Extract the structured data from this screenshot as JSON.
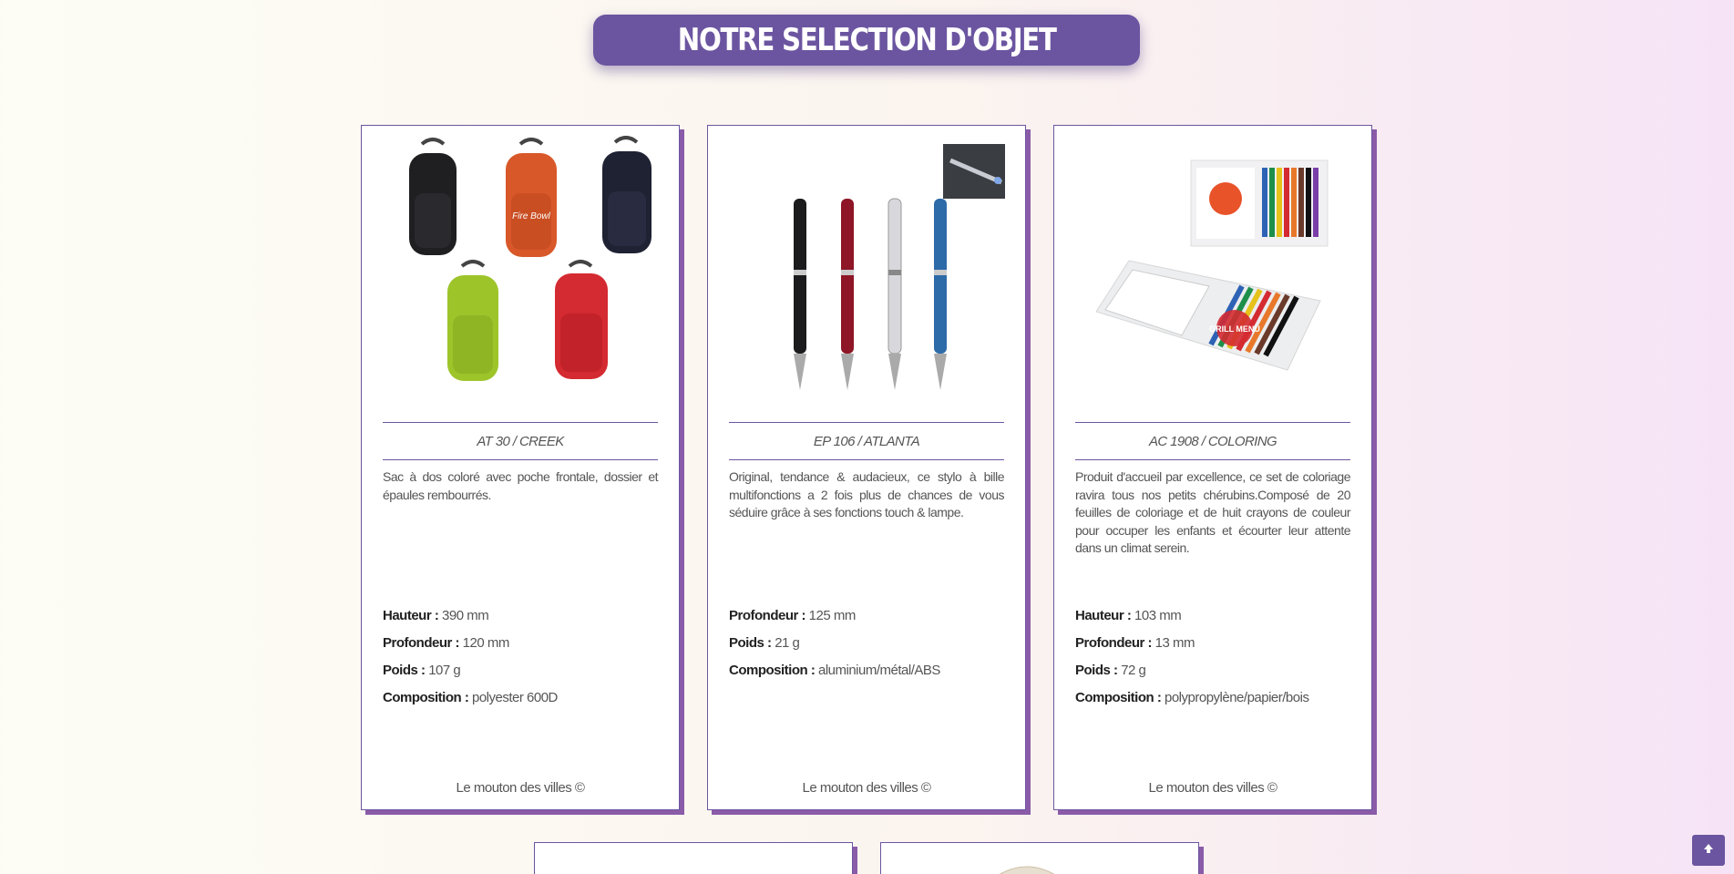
{
  "page": {
    "title": "NOTRE SELECTION D'OBJET"
  },
  "products": [
    {
      "ref": "AT 30 / CREEK",
      "description": "Sac à dos coloré avec poche frontale, dossier et épaules rembourrés.",
      "specs": [
        {
          "label": "Hauteur :",
          "value": "390 mm"
        },
        {
          "label": "Profondeur :",
          "value": "120 mm"
        },
        {
          "label": "Poids :",
          "value": "107 g"
        },
        {
          "label": "Composition :",
          "value": "polyester 600D"
        }
      ],
      "copyright": "Le mouton des villes ©",
      "image_text": "Fire Bowl"
    },
    {
      "ref": "EP 106 / ATLANTA",
      "description": "Original, tendance & audacieux, ce stylo à bille multifonctions a 2 fois plus de chances de vous séduire grâce à ses fonctions touch & lampe.",
      "specs": [
        {
          "label": "Profondeur :",
          "value": "125 mm"
        },
        {
          "label": "Poids :",
          "value": "21 g"
        },
        {
          "label": "Composition :",
          "value": "aluminium/métal/ABS"
        }
      ],
      "copyright": "Le mouton des villes ©"
    },
    {
      "ref": "AC 1908 / COLORING",
      "description": "Produit d'accueil par excellence, ce set de coloriage ravira tous nos petits chérubins.Composé de 20 feuilles de coloriage et de huit crayons de couleur pour occuper les enfants et écourter leur attente dans un climat serein.",
      "specs": [
        {
          "label": "Hauteur :",
          "value": "103 mm"
        },
        {
          "label": "Profondeur :",
          "value": "13 mm"
        },
        {
          "label": "Poids :",
          "value": "72 g"
        },
        {
          "label": "Composition :",
          "value": "polypropylène/papier/bois"
        }
      ],
      "copyright": "Le mouton des villes ©",
      "image_text": "GRILL MENU"
    }
  ],
  "icons": {
    "scroll_top": "arrow-up-icon"
  },
  "colors": {
    "accent": "#6b55a0",
    "card_shadow": "#8a5ba8"
  }
}
